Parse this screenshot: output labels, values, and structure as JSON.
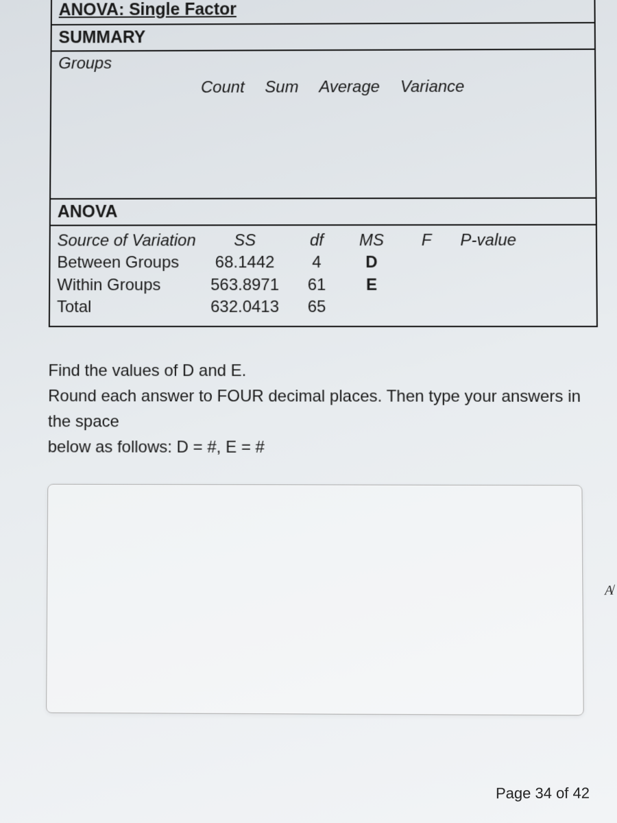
{
  "title": "ANOVA: Single Factor",
  "summary": {
    "label": "SUMMARY",
    "groups_label": "Groups",
    "headers": {
      "count": "Count",
      "sum": "Sum",
      "average": "Average",
      "variance": "Variance"
    }
  },
  "anova": {
    "label": "ANOVA",
    "headers": {
      "source": "Source of Variation",
      "ss": "SS",
      "df": "df",
      "ms": "MS",
      "f": "F",
      "pvalue": "P-value"
    },
    "rows": [
      {
        "source": "Between Groups",
        "ss": "68.1442",
        "df": "4",
        "ms": "D",
        "f": "",
        "pvalue": ""
      },
      {
        "source": "Within Groups",
        "ss": "563.8971",
        "df": "61",
        "ms": "E",
        "f": "",
        "pvalue": ""
      },
      {
        "source": "Total",
        "ss": "632.0413",
        "df": "65",
        "ms": "",
        "f": "",
        "pvalue": ""
      }
    ]
  },
  "question": {
    "line1": "Find the values of D and E.",
    "line2": "Round each answer to FOUR decimal places. Then type your answers in the space",
    "line3": "below as follows:  D = #, E = #"
  },
  "answer_value": "",
  "format_icon": "A̸",
  "page_label": "Page 34 of 42"
}
